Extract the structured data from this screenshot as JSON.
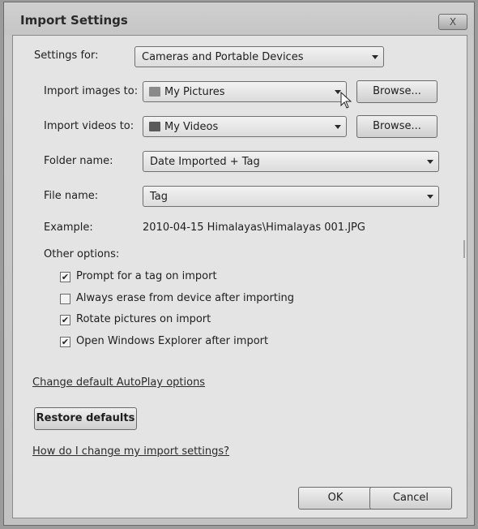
{
  "window": {
    "title": "Import Settings",
    "close_glyph": "X"
  },
  "settings_for": {
    "label": "Settings for:",
    "value": "Cameras and Portable Devices"
  },
  "import_images": {
    "label": "Import images to:",
    "value": "My Pictures",
    "icon": "pictures-folder-icon"
  },
  "import_videos": {
    "label": "Import videos to:",
    "value": "My Videos",
    "icon": "videos-folder-icon"
  },
  "browse_label": "Browse...",
  "folder_name": {
    "label": "Folder name:",
    "value": "Date Imported + Tag"
  },
  "file_name": {
    "label": "File name:",
    "value": "Tag"
  },
  "example": {
    "label": "Example:",
    "value": "2010-04-15 Himalayas\\Himalayas 001.JPG"
  },
  "other_options": {
    "label": "Other options:",
    "items": [
      {
        "label": "Prompt for a tag on import",
        "checked": true
      },
      {
        "label": "Always erase from device after importing",
        "checked": false
      },
      {
        "label": "Rotate pictures on import",
        "checked": true
      },
      {
        "label": "Open Windows Explorer after import",
        "checked": true
      }
    ]
  },
  "links": {
    "autoplay": "Change default AutoPlay options",
    "help": "How do I change my import settings?"
  },
  "buttons": {
    "restore": "Restore defaults",
    "ok": "OK",
    "cancel": "Cancel"
  }
}
